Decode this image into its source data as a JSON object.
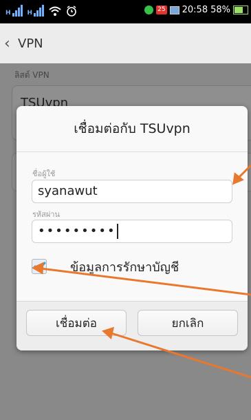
{
  "status_bar": {
    "time": "20:58",
    "battery": "58%",
    "notification_count": "25",
    "icons": [
      "signal-sim1-icon",
      "signal-sim2-icon",
      "wifi-icon",
      "alarm-icon",
      "app-notification-icon",
      "calendar-icon",
      "image-icon",
      "battery-icon"
    ]
  },
  "action_bar": {
    "title": "VPN",
    "back_icon": "chevron-left-icon"
  },
  "content": {
    "section_label": "ลิสต์ VPN",
    "vpn_item_name": "TSUvpn"
  },
  "dialog": {
    "title": "เชื่อมต่อกับ TSUvpn",
    "username_label": "ชื่อผู้ใช้",
    "username_value": "syanawut",
    "password_label": "รหัสผ่าน",
    "password_mask": "•••••••••",
    "save_account_label": "ข้อมูลการรักษาบัญชี",
    "save_account_checked": true,
    "connect_button": "เชื่อมต่อ",
    "cancel_button": "ยกเลิก"
  },
  "colors": {
    "annotation_arrow": "#e8782e",
    "checkmark": "#3aa0e0",
    "status_bar_bg": "#000000"
  }
}
